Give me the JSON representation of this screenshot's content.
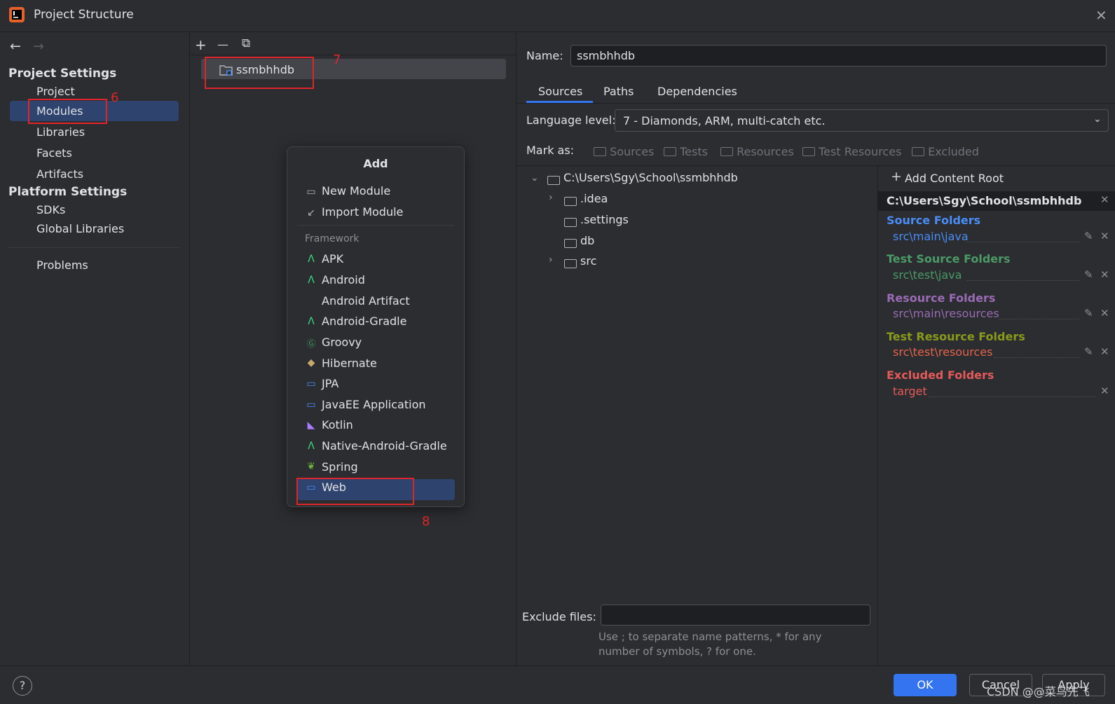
{
  "window": {
    "title": "Project Structure",
    "close": "✕"
  },
  "nav": {
    "back": "←",
    "forward": "→"
  },
  "left": {
    "project_settings": "Project Settings",
    "items": [
      "Project",
      "Modules",
      "Libraries",
      "Facets",
      "Artifacts"
    ],
    "platform_settings": "Platform Settings",
    "platform_items": [
      "SDKs",
      "Global Libraries"
    ],
    "problems": "Problems"
  },
  "toolbar": {
    "add": "+",
    "remove": "—",
    "copy": "⧉"
  },
  "module": {
    "name": "ssmbhhdb"
  },
  "annotations": {
    "n6": "6",
    "n7": "7",
    "n8": "8"
  },
  "popup": {
    "title": "Add",
    "items": [
      "New Module",
      "Import Module"
    ],
    "group": "Framework",
    "frameworks": [
      "APK",
      "Android",
      "Android Artifact",
      "Android-Gradle",
      "Groovy",
      "Hibernate",
      "JPA",
      "JavaEE Application",
      "Kotlin",
      "Native-Android-Gradle",
      "Spring",
      "Web"
    ]
  },
  "details": {
    "name_label": "Name:",
    "name_value": "ssmbhhdb",
    "tabs": [
      "Sources",
      "Paths",
      "Dependencies"
    ],
    "language_label": "Language level:",
    "language_value": "7 - Diamonds, ARM, multi-catch etc.",
    "mark_as": "Mark as:",
    "marks": [
      "Sources",
      "Tests",
      "Resources",
      "Test Resources",
      "Excluded"
    ],
    "tree": {
      "root": "C:\\Users\\Sgy\\School\\ssmbhhdb",
      "children": [
        ".idea",
        ".settings",
        "db",
        "src"
      ]
    },
    "exclude_label": "Exclude files:",
    "exclude_value": "",
    "hint": [
      "Use ; to separate name patterns, * for any",
      "number of symbols, ? for one."
    ]
  },
  "content_root": {
    "add_label": "Add Content Root",
    "path": "C:\\Users\\Sgy\\School\\ssmbhhdb",
    "groups": [
      {
        "title": "Source Folders",
        "path": "src\\main\\java",
        "color": "#4a8cf7"
      },
      {
        "title": "Test Source Folders",
        "path": "src\\test\\java",
        "color": "#4b9a67"
      },
      {
        "title": "Resource Folders",
        "path": "src\\main\\resources",
        "color": "#9a6bb5"
      },
      {
        "title": "Test Resource Folders",
        "path": "src\\test\\resources",
        "color": "#8a9a1c",
        "path_color": "#e5634a"
      },
      {
        "title": "Excluded Folders",
        "path": "target",
        "color": "#e55a5a"
      }
    ]
  },
  "buttons": {
    "ok": "OK",
    "cancel": "Cancel",
    "apply": "Apply",
    "help": "?"
  },
  "watermark": "CSDN @@菜鸟先飞"
}
